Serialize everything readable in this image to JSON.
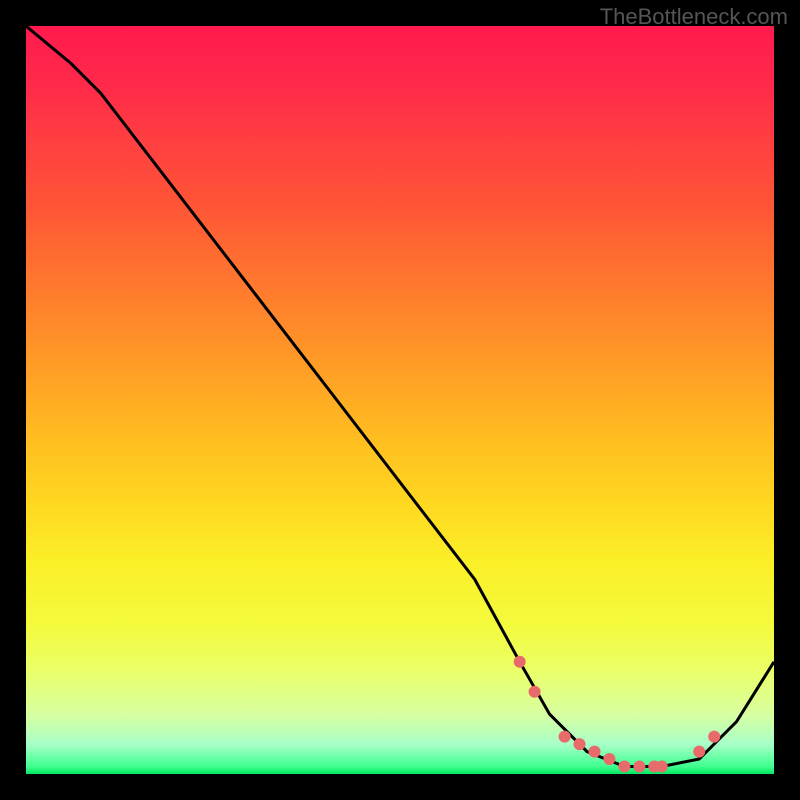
{
  "watermark": "TheBottleneck.com",
  "chart_data": {
    "type": "line",
    "title": "",
    "xlabel": "",
    "ylabel": "",
    "xlim": [
      0,
      100
    ],
    "ylim": [
      0,
      100
    ],
    "grid": false,
    "series": [
      {
        "name": "curve",
        "x": [
          0,
          6,
          10,
          20,
          30,
          40,
          50,
          60,
          66,
          70,
          75,
          80,
          85,
          90,
          95,
          100
        ],
        "values": [
          100,
          95,
          91,
          78,
          65,
          52,
          39,
          26,
          15,
          8,
          3,
          1,
          1,
          2,
          7,
          15
        ]
      }
    ],
    "markers": {
      "name": "dots",
      "x": [
        66,
        68,
        72,
        74,
        76,
        78,
        80,
        82,
        84,
        85,
        90,
        92
      ],
      "values": [
        15,
        11,
        5,
        4,
        3,
        2,
        1,
        1,
        1,
        1,
        3,
        5
      ],
      "color": "#e96a6a",
      "radius": 6
    },
    "colors": {
      "curve_stroke": "#000000",
      "gradient_top": "#ff1a4d",
      "gradient_mid": "#ffd820",
      "gradient_bottom": "#00e860"
    }
  }
}
